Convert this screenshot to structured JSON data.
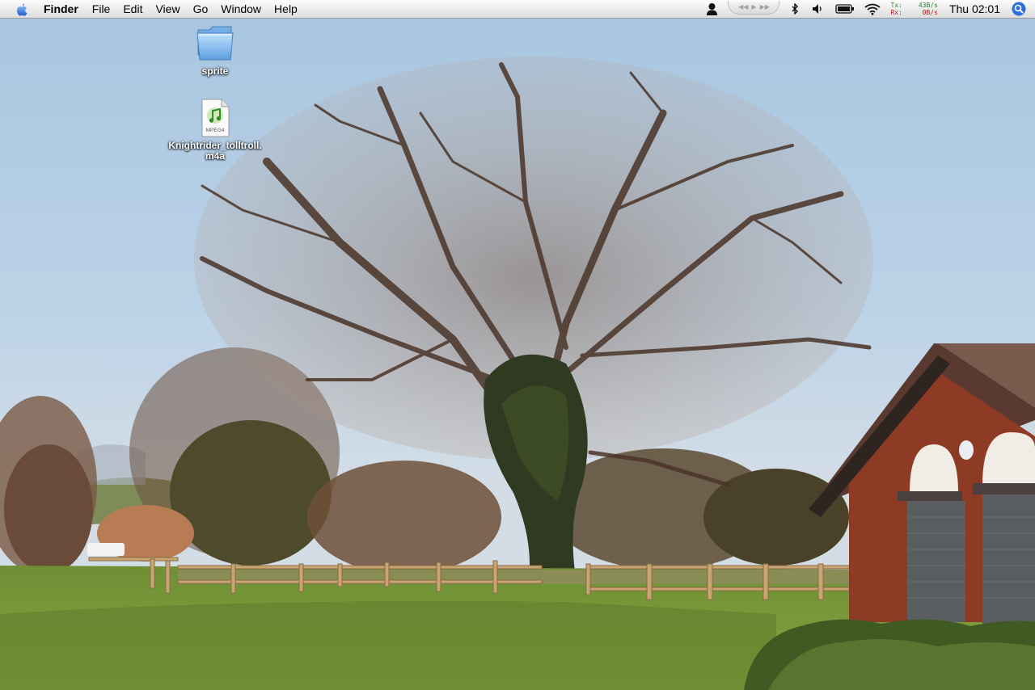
{
  "menubar": {
    "apple_icon": "apple-icon",
    "app_name": "Finder",
    "menus": [
      "File",
      "Edit",
      "View",
      "Go",
      "Window",
      "Help"
    ],
    "status_icons": [
      "user-silhouette-icon",
      "itunes-controller-icon",
      "bluetooth-icon",
      "volume-icon",
      "battery-icon",
      "wifi-icon"
    ],
    "network": {
      "tx_label": "Tx:",
      "rx_label": "Rx:",
      "tx_value": "43B/s",
      "rx_value": "0B/s"
    },
    "clock": "Thu 02:01",
    "spotlight_icon": "spotlight-icon"
  },
  "desktop": {
    "icons": [
      {
        "label": "sprite",
        "icon": "folder-icon"
      },
      {
        "label": "Knightrider_tolltroll.\nm4a",
        "icon": "mpeg4-audio-file-icon",
        "badge": "MPEG4"
      }
    ]
  },
  "colors": {
    "menubar_bg": "#ececec",
    "sky": "#b4cfe5",
    "grass": "#7a9c3a",
    "brick": "#8e3b26",
    "spotlight": "#2a6fdb",
    "tx_text": "#2f7a2f",
    "rx_text": "#b01818"
  }
}
